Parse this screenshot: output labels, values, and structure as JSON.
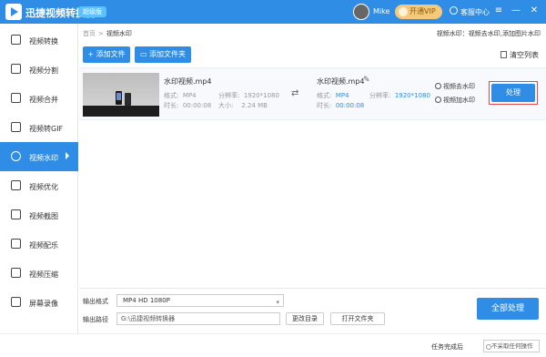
{
  "app": {
    "title": "迅捷视频转换器",
    "badge": "超级版",
    "username": "Mike",
    "vip_label": "开通VIP",
    "service_label": "客服中心",
    "controls": [
      "≡",
      "—",
      "✕"
    ]
  },
  "sidebar": {
    "items": [
      {
        "label": "视频转换",
        "icon": "video-convert-icon"
      },
      {
        "label": "视频分割",
        "icon": "video-split-icon"
      },
      {
        "label": "视频合并",
        "icon": "video-merge-icon"
      },
      {
        "label": "视频转GIF",
        "icon": "gif-icon"
      },
      {
        "label": "视频水印",
        "icon": "watermark-icon",
        "active": true
      },
      {
        "label": "视频优化",
        "icon": "optimize-icon"
      },
      {
        "label": "视频截图",
        "icon": "screenshot-icon"
      },
      {
        "label": "视频配乐",
        "icon": "music-icon"
      },
      {
        "label": "视频压缩",
        "icon": "compress-icon"
      },
      {
        "label": "屏幕录像",
        "icon": "screen-record-icon"
      }
    ]
  },
  "breadcrumb": {
    "home": "首页",
    "sep": ">",
    "current": "视频水印"
  },
  "hint": "视频水印：视频去水印,添加图片水印",
  "toolbar": {
    "add_file": "添加文件",
    "add_folder": "添加文件夹",
    "clear_list": "清空列表"
  },
  "file": {
    "source_name": "水印视频.mp4",
    "source_format_label": "格式:",
    "source_format": "MP4",
    "source_res_label": "分辨率:",
    "source_res": "1920*1080",
    "source_dur_label": "时长:",
    "source_dur": "00:00:08",
    "source_size_label": "大小:",
    "source_size": "2.24 MB",
    "output_name": "水印视频.mp4",
    "output_format_label": "格式:",
    "output_format": "MP4",
    "output_res_label": "分辨率:",
    "output_res": "1920*1080",
    "output_dur_label": "时长:",
    "output_dur": "00:00:08",
    "remove_watermark": "视频去水印",
    "add_watermark": "视频加水印",
    "process_label": "处理"
  },
  "bottom": {
    "format_label": "输出格式",
    "format_value": "MP4   HD 1080P",
    "path_label": "输出路径",
    "path_value": "G:\\迅捷视频转换器",
    "change_dir": "更改目录",
    "open_folder": "打开文件夹",
    "process_all": "全部处理"
  },
  "status": {
    "after_label": "任务完成后",
    "after_value": "不采取任何操作"
  }
}
